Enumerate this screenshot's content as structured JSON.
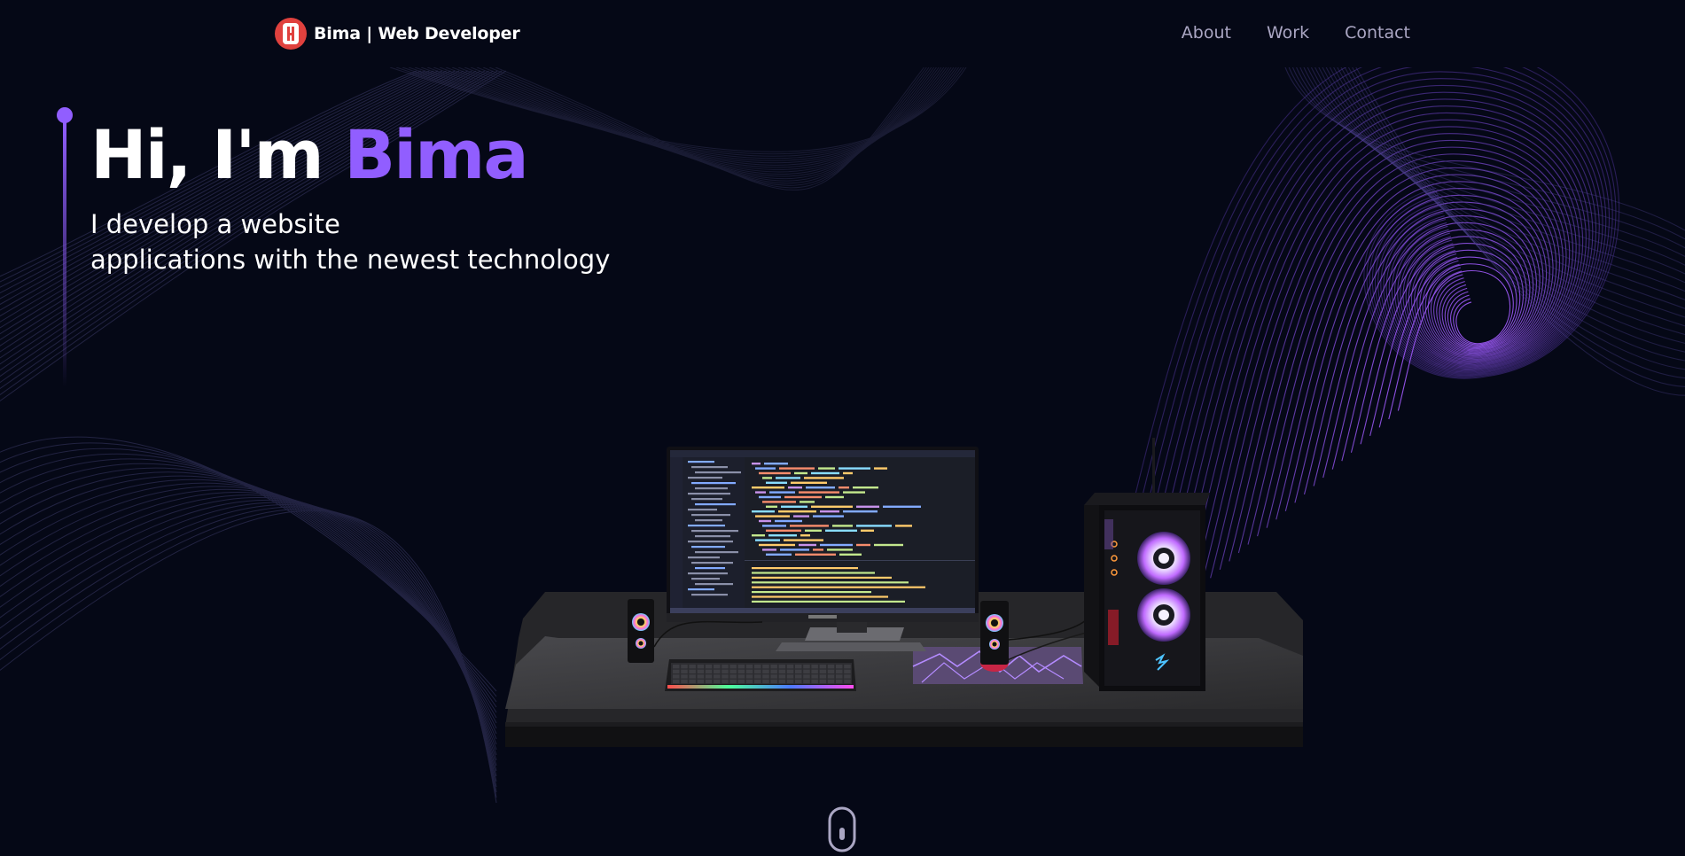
{
  "nav": {
    "brand": "Bima | Web Developer",
    "links": [
      "About",
      "Work",
      "Contact"
    ]
  },
  "hero": {
    "greeting": "Hi, I'm ",
    "name": "Bima",
    "subtitle_line1": "I develop a website",
    "subtitle_line2": "applications with the newest technology"
  },
  "colors": {
    "background": "#050816",
    "accent": "#915eff",
    "logo": "#e0413e",
    "nav_text": "#aaa6c3"
  },
  "icons": {
    "logo": "logo-icon",
    "scroll": "mouse-scroll-icon"
  }
}
